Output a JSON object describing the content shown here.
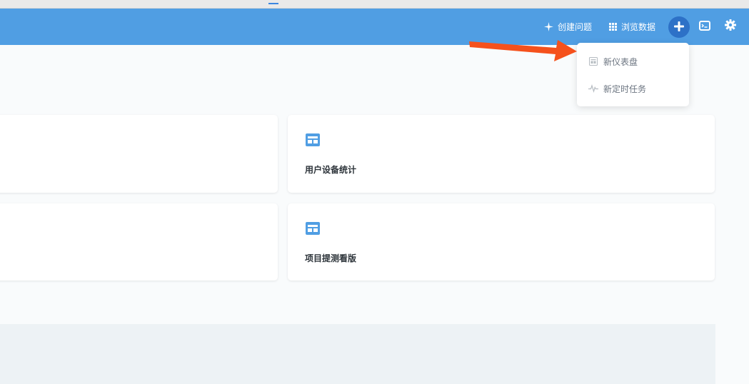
{
  "topbar": {
    "create_question_label": "创建问题",
    "browse_data_label": "浏览数据",
    "accent_color": "#509ee3",
    "plus_button_color": "#2d71c7"
  },
  "new_menu": {
    "items": [
      {
        "label": "新仪表盘",
        "icon": "dashboard-icon"
      },
      {
        "label": "新定时任务",
        "icon": "pulse-icon"
      }
    ]
  },
  "cards": [
    {
      "title": "用户设备统计",
      "icon": "dashboard-icon"
    },
    {
      "title": "项目提测看版",
      "icon": "dashboard-icon"
    }
  ],
  "annotation": {
    "arrow_color": "#f5511c"
  }
}
